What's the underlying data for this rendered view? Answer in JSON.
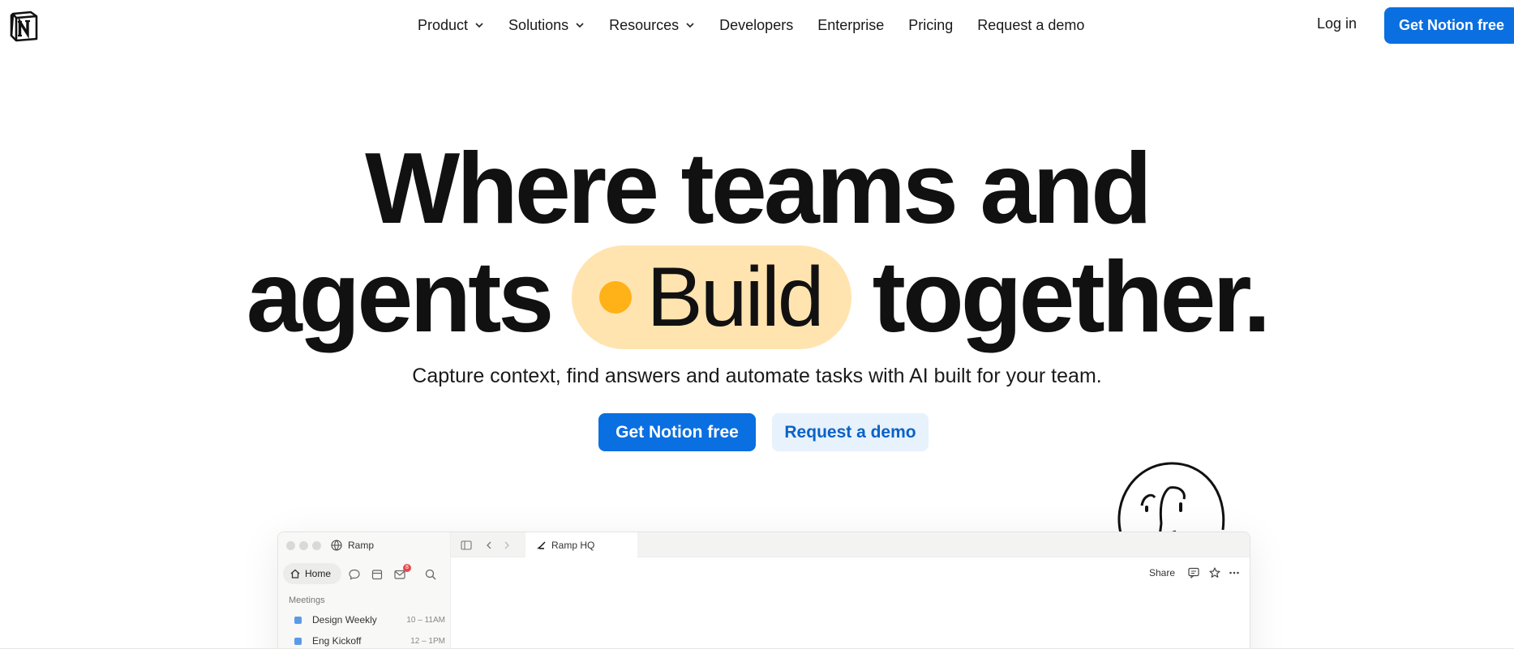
{
  "nav": {
    "links": [
      {
        "label": "Product",
        "dropdown": true
      },
      {
        "label": "Solutions",
        "dropdown": true
      },
      {
        "label": "Resources",
        "dropdown": true
      },
      {
        "label": "Developers",
        "dropdown": false
      },
      {
        "label": "Enterprise",
        "dropdown": false
      },
      {
        "label": "Pricing",
        "dropdown": false
      },
      {
        "label": "Request a demo",
        "dropdown": false
      }
    ],
    "login": "Log in",
    "cta": "Get Notion free"
  },
  "hero": {
    "line1": "Where teams and",
    "line2_before": "agents",
    "pill": "Build",
    "line2_after": "together.",
    "subtitle": "Capture context, find answers and automate tasks with AI built for your team.",
    "primary_cta": "Get Notion free",
    "secondary_cta": "Request a demo"
  },
  "mockup": {
    "workspace": "Ramp",
    "home_label": "Home",
    "inbox_badge": "8",
    "section_label": "Meetings",
    "meetings": [
      {
        "name": "Design Weekly",
        "time": "10 – 11AM"
      },
      {
        "name": "Eng Kickoff",
        "time": "12 – 1PM"
      }
    ],
    "tab_title": "Ramp HQ",
    "share_label": "Share"
  },
  "colors": {
    "brand_blue": "#0a6fe0",
    "pill_bg": "#ffe4b0",
    "pill_dot": "#ffb118",
    "secondary_bg": "#e7f2fd"
  }
}
